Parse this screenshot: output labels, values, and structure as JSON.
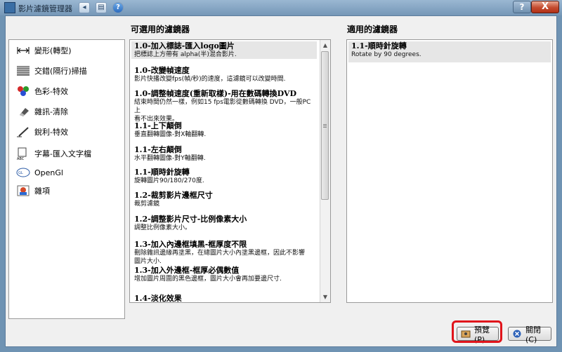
{
  "window": {
    "title": "影片濾鏡管理器",
    "help_label": "?",
    "close_label": "X"
  },
  "quick_access": [
    "◂",
    "▤",
    "?"
  ],
  "headers": {
    "available": "可選用的濾鏡器",
    "applied": "適用的濾鏡器"
  },
  "categories": [
    {
      "label": "變形(轉型)",
      "icon": "arrows-icon"
    },
    {
      "label": "交錯(隔行)掃描",
      "icon": "interlace-icon"
    },
    {
      "label": "色彩-特效",
      "icon": "color-balls-icon"
    },
    {
      "label": "雜訊-清除",
      "icon": "eraser-icon"
    },
    {
      "label": "銳利-特效",
      "icon": "pen-icon"
    },
    {
      "label": "字幕-匯入文字檔",
      "icon": "subtitle-icon"
    },
    {
      "label": "OpenGl",
      "icon": "opengl-icon"
    },
    {
      "label": "雜項",
      "icon": "misc-icon"
    }
  ],
  "filters": [
    {
      "title": "1.0-加入標誌-匯入logo圖片",
      "desc": [
        "把標誌上方帶有 alpha(半)混合影片."
      ]
    },
    {
      "title": "1.0-改變幀速度",
      "desc": [
        "影片快播改變fps(幀/秒)的速度，這濾鏡可以改變時間."
      ]
    },
    {
      "title": "1.0-調整幀速度(重新取樣)-用在數碼轉換DVD",
      "desc": [
        "結束時間仍然一樣，例如15 fps電影從數碼轉換 DVD，一般PC上",
        "看不出來效果。"
      ]
    },
    {
      "title": "1.1-上下顛倒",
      "desc": [
        "垂直翻轉圖像-對X軸翻轉."
      ]
    },
    {
      "title": "1.1-左右顛倒",
      "desc": [
        "水平翻轉圖像-對Y軸翻轉."
      ]
    },
    {
      "title": "1.1-順時針旋轉",
      "desc": [
        "旋轉圖片90/180/270度."
      ]
    },
    {
      "title": "1.2-裁剪影片邊框尺寸",
      "desc": [
        "裁剪濾鏡"
      ]
    },
    {
      "title": "1.2-調整影片尺寸-比例像素大小",
      "desc": [
        "調整比例像素大小。"
      ]
    },
    {
      "title": "1.3-加入內邊框填黑-框厚度不限",
      "desc": [
        "刪除雜訊邊緣再塗黑，在總圖片大小內塗黑邊框，因此不影響",
        "圖片大小."
      ]
    },
    {
      "title": "1.3-加入外邊框-框厚必偶數值",
      "desc": [
        "增加圖片周圍的黑色邊框，圖片大小會再加要邊尺寸."
      ]
    },
    {
      "title": "1.4-淡化效果",
      "desc": []
    }
  ],
  "applied": [
    {
      "title": "1.1-順時針旋轉",
      "desc": "Rotate by 90 degrees."
    }
  ],
  "buttons": {
    "preview": "預覽(P)",
    "close": "關閉(C)"
  },
  "colors": {
    "highlight": "#e0141b",
    "titlebar": "#7f9fbf"
  }
}
